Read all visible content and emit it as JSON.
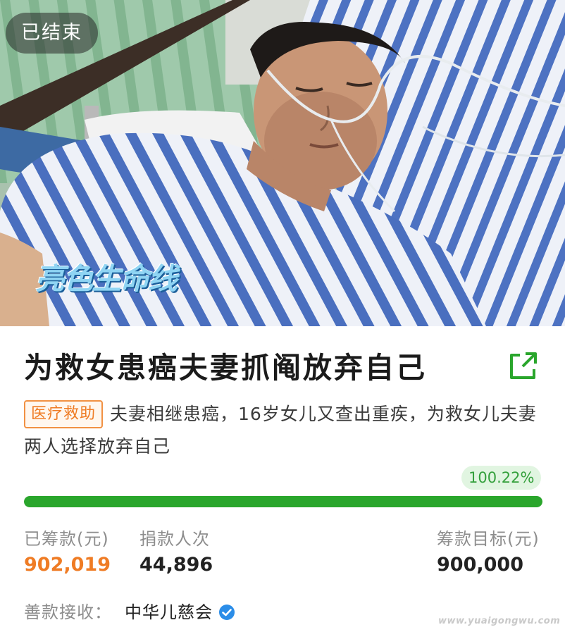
{
  "hero": {
    "status_label": "已结束",
    "watermark_logo": "亮色生命线"
  },
  "campaign": {
    "title": "为救女患癌夫妻抓阄放弃自己",
    "category_tag": "医疗救助",
    "description": "夫妻相继患癌，16岁女儿又查出重疾，为救女儿夫妻两人选择放弃自己",
    "progress_label": "100.22%",
    "progress_fraction": 1.0
  },
  "stats": {
    "raised_label": "已筹款(元)",
    "raised_value": "902,019",
    "donors_label": "捐款人次",
    "donors_value": "44,896",
    "goal_label": "筹款目标(元)",
    "goal_value": "900,000"
  },
  "recipient": {
    "label": "善款接收：",
    "name": "中华儿慈会"
  },
  "site_watermark": "www.yuaigongwu.com",
  "colors": {
    "accent_green": "#2aa62c",
    "tag_orange": "#ef7c25",
    "verified_blue": "#2b8de8"
  },
  "icons": [
    "share-icon",
    "verified-icon"
  ]
}
